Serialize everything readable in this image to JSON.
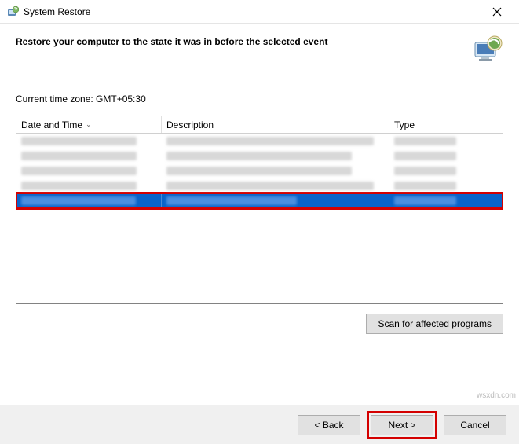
{
  "window": {
    "title": "System Restore"
  },
  "header": {
    "heading": "Restore your computer to the state it was in before the selected event"
  },
  "timezone": {
    "label": "Current time zone: GMT+05:30"
  },
  "table": {
    "columns": {
      "date": "Date and Time",
      "desc": "Description",
      "type": "Type"
    }
  },
  "buttons": {
    "scan": "Scan for affected programs",
    "back": "< Back",
    "next": "Next >",
    "cancel": "Cancel"
  },
  "watermark": "wsxdn.com"
}
